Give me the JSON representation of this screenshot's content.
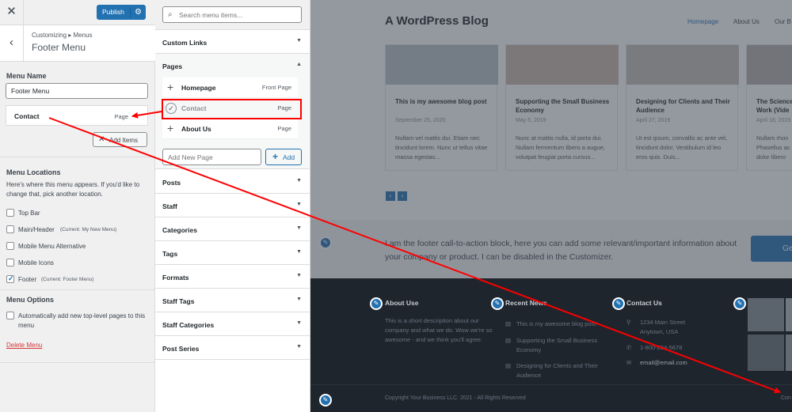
{
  "customizer": {
    "close_label": "✕",
    "publish_label": "Publish",
    "breadcrumb": "Customizing ▸ Menus",
    "title": "Footer Menu",
    "menu_name_label": "Menu Name",
    "menu_name_value": "Footer Menu",
    "menu_items": [
      {
        "name": "Contact",
        "type": "Page"
      }
    ],
    "add_items_label": "Add Items",
    "menu_locations_label": "Menu Locations",
    "menu_locations_desc": "Here's where this menu appears. If you'd like to change that, pick another location.",
    "locations": [
      {
        "label": "Top Bar",
        "note": "",
        "checked": false
      },
      {
        "label": "Main/Header",
        "note": "(Current: My New Menu)",
        "checked": false
      },
      {
        "label": "Mobile Menu Alternative",
        "note": "",
        "checked": false
      },
      {
        "label": "Mobile Icons",
        "note": "",
        "checked": false
      },
      {
        "label": "Footer",
        "note": "(Current: Footer Menu)",
        "checked": true
      }
    ],
    "menu_options_label": "Menu Options",
    "option_auto_add": "Automatically add new top-level pages to this menu",
    "delete_label": "Delete Menu"
  },
  "items_panel": {
    "search_placeholder": "Search menu items...",
    "custom_links": "Custom Links",
    "pages_label": "Pages",
    "pages": [
      {
        "name": "Homepage",
        "type": "Front Page",
        "added": false
      },
      {
        "name": "Contact",
        "type": "Page",
        "added": true
      },
      {
        "name": "About Us",
        "type": "Page",
        "added": false
      }
    ],
    "add_new_page_placeholder": "Add New Page",
    "add_label": "Add",
    "sections": [
      "Posts",
      "Staff",
      "Categories",
      "Tags",
      "Formats",
      "Staff Tags",
      "Staff Categories",
      "Post Series"
    ]
  },
  "preview": {
    "site_title": "A WordPress Blog",
    "nav": [
      "Homepage",
      "About Us",
      "Our B"
    ],
    "posts": [
      {
        "title": "This is my awesome blog post",
        "date": "September 25, 2020",
        "excerpt": "Nullam vel mattis dui. Etiam nec tincidunt lorem. Nunc ut tellus vitae massa egestas..."
      },
      {
        "title": "Supporting the Small Business Economy",
        "date": "May 6, 2019",
        "excerpt": "Nunc at mattis nulla, id porta dui. Nullam fermentum libero a augue, volutpat feugiat porta cursus..."
      },
      {
        "title": "Designing for Clients and Their Audience",
        "date": "April 27, 2019",
        "excerpt": "Ut est ipsum, convallis ac ante vel, tincidunt dolor. Vestibulum id leo eros quis. Duis..."
      },
      {
        "title": "The Science Work (Vide",
        "date": "April 18, 2019",
        "excerpt": "Nullam rhon Phasellus ac dolor libero"
      }
    ],
    "cta_text": "I am the footer call-to-action block, here you can add some relevant/important information about your company or product. I can be disabled in the Customizer.",
    "cta_button": "Ge",
    "footer": {
      "about_title": "About Use",
      "about_text": "This is a short description about our company and what we do. Wow we're so awesome - and we think you'll agree.",
      "recent_title": "Recent News",
      "recent": [
        "This is my awesome blog post",
        "Supporting the Small Business Economy",
        "Designing for Clients and Their Audience"
      ],
      "contact_title": "Contact Us",
      "address1": "1234 Main Street",
      "address2": "Anytown, USA",
      "phone": "1-800-234-5678",
      "email": "email@email.com",
      "copyright": "Copyright Your Business LLC. 2021 - All Rights Reserved",
      "footer_link": "Con"
    }
  },
  "colors": {
    "accent": "#2271b1",
    "annotation": "#ff0000"
  }
}
